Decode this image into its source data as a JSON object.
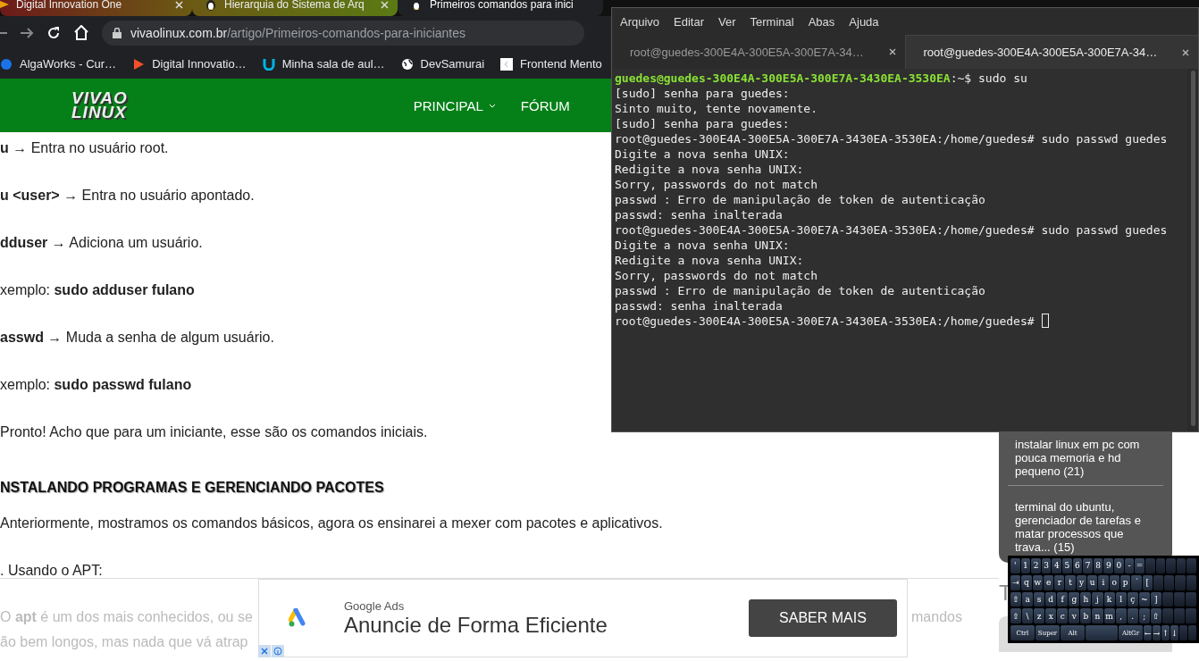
{
  "browser": {
    "tabs": [
      {
        "title": "Digital Innovation One",
        "selected": false
      },
      {
        "title": "Hierarquia do Sistema de Arq",
        "selected": false
      },
      {
        "title": "Primeiros comandos para inici",
        "selected": true
      }
    ],
    "url": {
      "host": "vivaolinux.com.br",
      "path": "/artigo/Primeiros-comandos-para-iniciantes"
    },
    "bookmarks": [
      "AlgaWorks - Cur…",
      "Digital Innovatio…",
      "Minha sala de aul…",
      "DevSamurai",
      "Frontend Mento"
    ]
  },
  "site": {
    "logo": [
      "VIVAO",
      "LINUX"
    ],
    "nav": [
      {
        "label": "PRINCIPAL",
        "dropdown": true
      },
      {
        "label": "FÓRUM",
        "dropdown": false
      }
    ]
  },
  "article": [
    {
      "kind": "line",
      "text": "**u** → Entra no usuário root."
    },
    {
      "kind": "line",
      "text": "**u <user>** → Entra no usuário apontado."
    },
    {
      "kind": "line",
      "text": "**dduser** → Adiciona um usuário."
    },
    {
      "kind": "line",
      "text": "xemplo: **sudo adduser fulano**"
    },
    {
      "kind": "line",
      "text": "**asswd** → Muda a senha de algum usuário."
    },
    {
      "kind": "line",
      "text": "xemplo: **sudo passwd fulano**"
    },
    {
      "kind": "line",
      "text": "Pronto! Acho que para um iniciante, esse são os comandos iniciais."
    },
    {
      "kind": "heading",
      "text": "NSTALANDO PROGRAMAS E GERENCIANDO PACOTES"
    },
    {
      "kind": "line",
      "text": "Anteriormente, mostramos os comandos básicos, agora os ensinarei a mexer com pacotes e aplicativos."
    },
    {
      "kind": "line",
      "text": ". Usando o APT:"
    }
  ],
  "footer": {
    "lines": [
      "O **apt** é um dos mais conhecidos, ou se",
      "ão bem longos, mas nada que vá atrap"
    ],
    "right_text": "mandos",
    "ad": {
      "brand": "Google Ads",
      "headline": "Anuncie de Forma Eficiente",
      "button": "SABER MAIS"
    }
  },
  "sidebar": {
    "items": [
      "instalar linux em pc com pouca memoria e hd pequeno (21)",
      "terminal do ubuntu, gerenciador de tarefas e matar processos que trava... (15)"
    ],
    "heading": "T"
  },
  "terminal": {
    "menu": [
      "Arquivo",
      "Editar",
      "Ver",
      "Terminal",
      "Abas",
      "Ajuda"
    ],
    "tabs": [
      {
        "title": "root@guedes-300E4A-300E5A-300E7A-34…",
        "selected": false
      },
      {
        "title": "root@guedes-300E4A-300E5A-300E7A-34…",
        "selected": true
      }
    ],
    "lines": [
      {
        "prompt": "guedes@guedes-300E4A-300E5A-300E7A-3430EA-3530EA",
        "text": ":~$ sudo su"
      },
      {
        "text": "[sudo] senha para guedes:"
      },
      {
        "text": "Sinto muito, tente novamente."
      },
      {
        "text": "[sudo] senha para guedes:"
      },
      {
        "text": "root@guedes-300E4A-300E5A-300E7A-3430EA-3530EA:/home/guedes# sudo passwd guedes"
      },
      {
        "text": "Digite a nova senha UNIX:"
      },
      {
        "text": "Redigite a nova senha UNIX:"
      },
      {
        "text": "Sorry, passwords do not match"
      },
      {
        "text": "passwd : Erro de manipulação de token de autenticação"
      },
      {
        "text": "passwd: senha inalterada"
      },
      {
        "text": "root@guedes-300E4A-300E5A-300E7A-3430EA-3530EA:/home/guedes# sudo passwd guedes"
      },
      {
        "text": "Digite a nova senha UNIX:"
      },
      {
        "text": "Redigite a nova senha UNIX:"
      },
      {
        "text": "Sorry, passwords do not match"
      },
      {
        "text": "passwd : Erro de manipulação de token de autenticação"
      },
      {
        "text": "passwd: senha inalterada"
      },
      {
        "text": "root@guedes-300E4A-300E5A-300E7A-3430EA-3530EA:/home/guedes#"
      }
    ],
    "cursor": true
  },
  "keyboard": {
    "rows": [
      {
        "keys": [
          "'",
          "1",
          "2",
          "3",
          "4",
          "5",
          "6",
          "7",
          "8",
          "9",
          "0",
          "-",
          "="
        ]
      },
      {
        "keys": [
          "⇥",
          "q",
          "w",
          "e",
          "r",
          "t",
          "y",
          "u",
          "i",
          "o",
          "p",
          "´",
          "["
        ]
      },
      {
        "keys": [
          "⇧",
          "a",
          "s",
          "d",
          "f",
          "g",
          "h",
          "j",
          "k",
          "l",
          "ç",
          "~",
          "]"
        ]
      },
      {
        "keys": [
          "⇧",
          "\\",
          "z",
          "x",
          "c",
          "v",
          "b",
          "n",
          "m",
          ",",
          ".",
          ";",
          "⇧"
        ]
      },
      {
        "keys": [
          "Ctrl",
          "Super",
          "Alt"
        ],
        "after_space": [
          "AltGr",
          "←",
          "→",
          "↑",
          "↓"
        ]
      }
    ]
  }
}
